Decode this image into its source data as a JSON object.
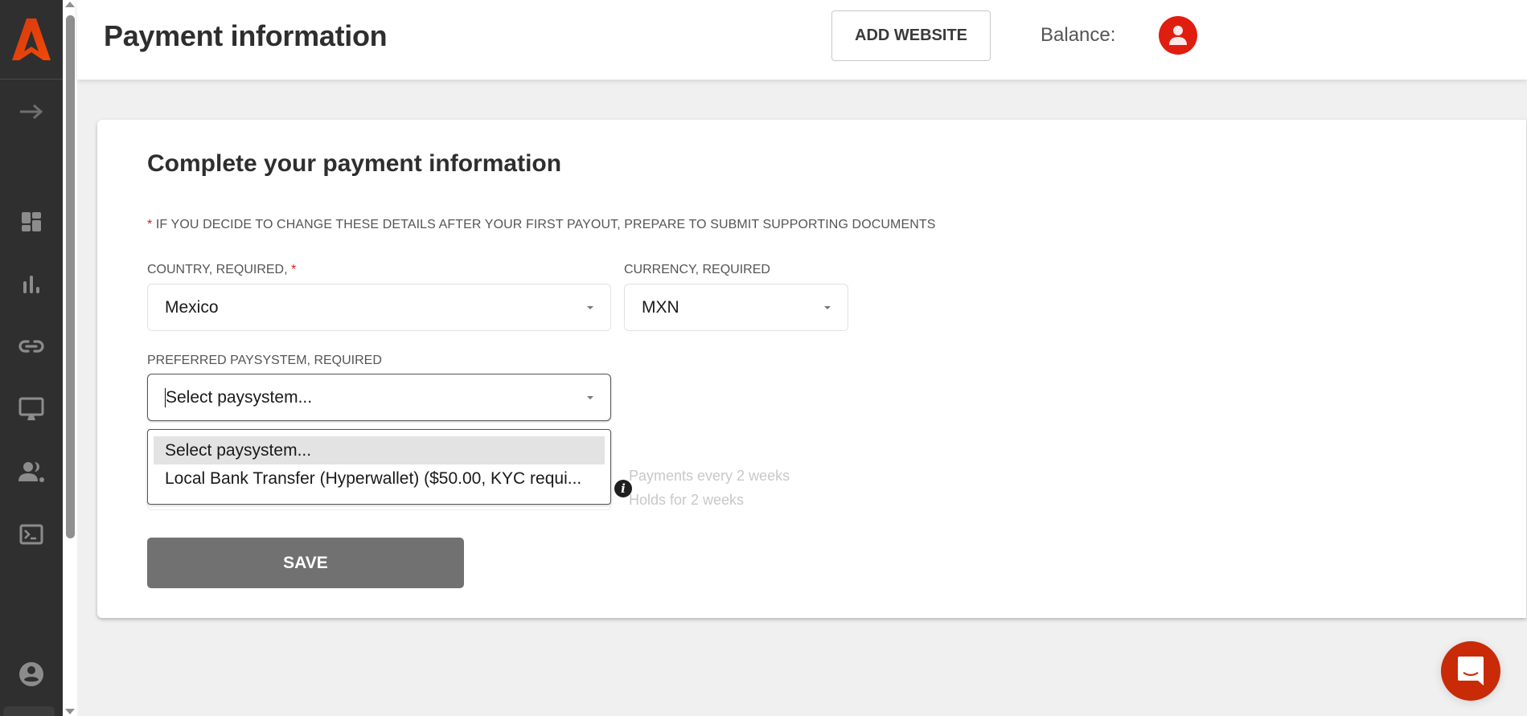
{
  "app": {
    "brand_color": "#e8400c",
    "accent_red": "#e01e10"
  },
  "sidebar": {
    "items": [
      {
        "name": "expand",
        "icon": "arrow-right-icon"
      },
      {
        "name": "dashboard",
        "icon": "dashboard-icon"
      },
      {
        "name": "statistics",
        "icon": "bar-chart-icon"
      },
      {
        "name": "links",
        "icon": "link-icon"
      },
      {
        "name": "websites",
        "icon": "monitor-icon"
      },
      {
        "name": "referrals",
        "icon": "people-icon"
      },
      {
        "name": "api",
        "icon": "terminal-icon"
      },
      {
        "name": "profile",
        "icon": "account-circle-icon"
      }
    ]
  },
  "header": {
    "title": "Payment information",
    "add_website_label": "ADD WEBSITE",
    "balance_label": "Balance:"
  },
  "card": {
    "title": "Complete your payment information",
    "notice_star": "*",
    "notice": " IF YOU DECIDE TO CHANGE THESE DETAILS AFTER YOUR FIRST PAYOUT, PREPARE TO SUBMIT SUPPORTING DOCUMENTS",
    "country": {
      "label": "COUNTRY, REQUIRED, ",
      "label_star": "*",
      "value": "Mexico"
    },
    "currency": {
      "label": "CURRENCY, REQUIRED",
      "value": "MXN"
    },
    "paysystem": {
      "label": "PREFERRED PAYSYSTEM, REQUIRED",
      "value": "Select paysystem...",
      "options": [
        {
          "label": "Select paysystem...",
          "highlighted": true
        },
        {
          "label": "Local Bank Transfer (Hyperwallet) ($50.00, KYC requi...",
          "highlighted": false
        }
      ]
    },
    "pay_info": {
      "frequency": "Payments every 2 weeks",
      "hold": "Holds for 2 weeks"
    },
    "save_label": "SAVE"
  },
  "chat": {
    "icon": "chat-icon",
    "color": "#c92a08"
  }
}
